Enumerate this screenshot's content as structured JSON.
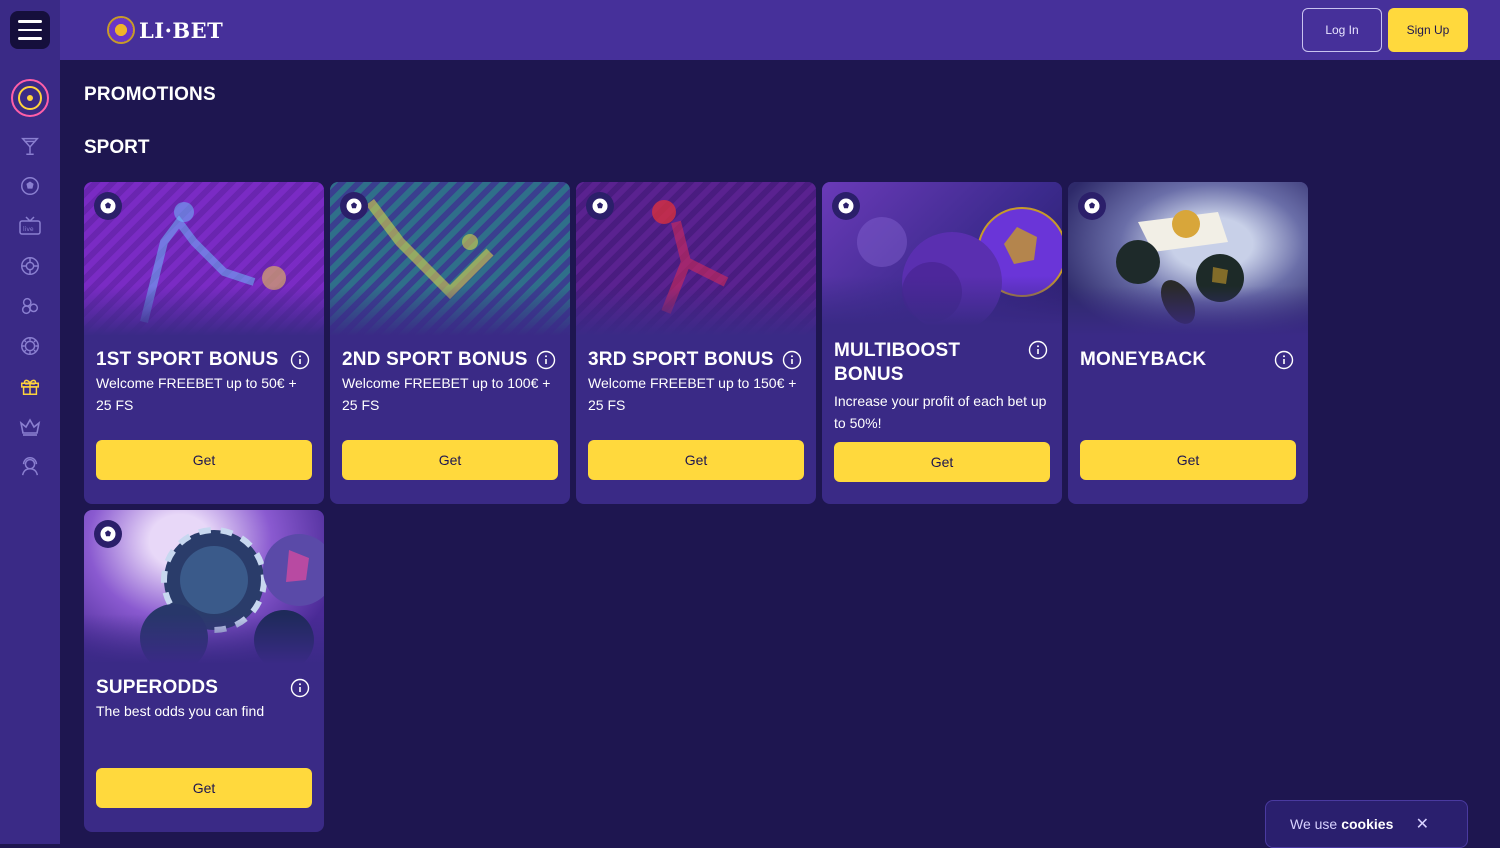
{
  "brand": {
    "name": "LI·BET"
  },
  "header": {
    "login_label": "Log In",
    "signup_label": "Sign Up"
  },
  "sidebar": {
    "items": [
      {
        "icon": "target-icon"
      },
      {
        "icon": "cocktail-icon"
      },
      {
        "icon": "soccer-ball-icon"
      },
      {
        "icon": "live-tv-icon"
      },
      {
        "icon": "roulette-icon"
      },
      {
        "icon": "lottery-balls-icon"
      },
      {
        "icon": "poker-chip-icon"
      },
      {
        "icon": "gift-icon"
      },
      {
        "icon": "crown-icon"
      },
      {
        "icon": "support-agent-icon"
      }
    ]
  },
  "main": {
    "page_title": "PROMOTIONS",
    "section_title": "SPORT",
    "cards": [
      {
        "title": "1ST SPORT BONUS",
        "desc": "Welcome FREEBET up to 50€ + 25 FS",
        "button": "Get"
      },
      {
        "title": "2ND SPORT BONUS",
        "desc": "Welcome FREEBET up to 100€ + 25 FS",
        "button": "Get"
      },
      {
        "title": "3RD SPORT BONUS",
        "desc": "Welcome FREEBET up to 150€ + 25 FS",
        "button": "Get"
      },
      {
        "title": "MULTIBOOST BONUS",
        "desc": "Increase your profit of each bet up to 50%!",
        "button": "Get"
      },
      {
        "title": "MONEYBACK",
        "desc": "",
        "button": "Get"
      },
      {
        "title": "SUPERODDS",
        "desc": "The best odds you can find",
        "button": "Get"
      }
    ]
  },
  "cookie": {
    "text": "We use",
    "link": "cookies"
  },
  "colors": {
    "accent": "#ffd93d",
    "sidebar": "#3a2a86",
    "header": "#46309a",
    "background": "#1e1650"
  }
}
